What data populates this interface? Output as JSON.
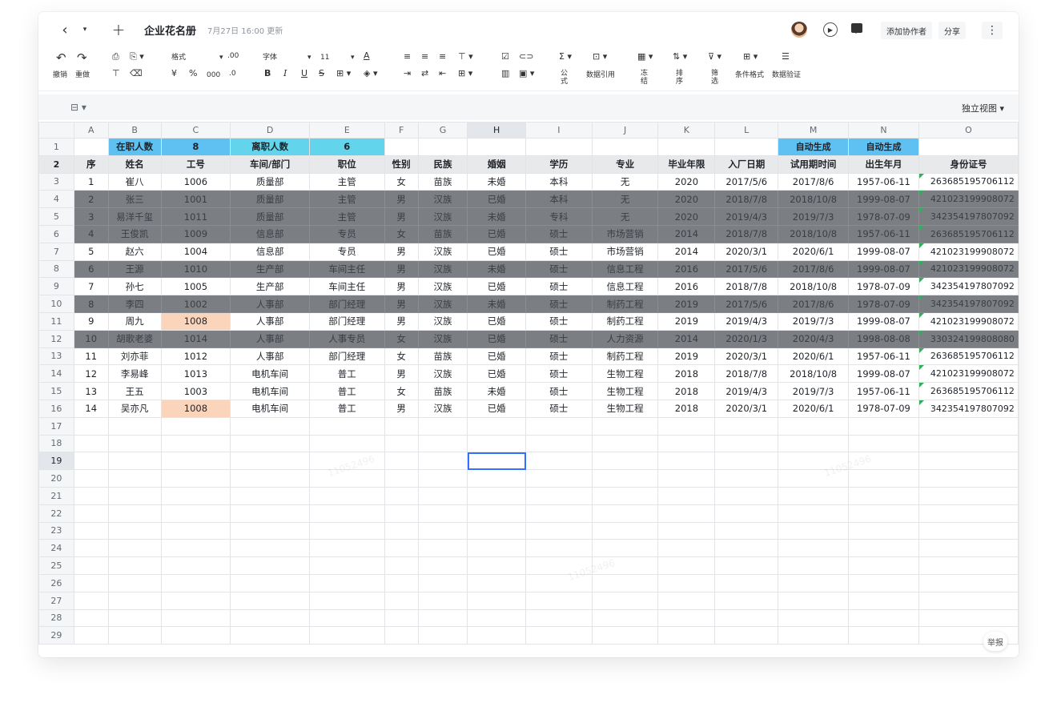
{
  "titlebar": {
    "back": "‹",
    "dropdown": "▾",
    "add": "+",
    "title": "企业花名册",
    "updated": "7月27日 16:00 更新",
    "add_collaborator": "添加协作者",
    "share": "分享",
    "more": "⋮"
  },
  "toolbar": {
    "undo": "撤销",
    "redo": "重做",
    "format": "格式",
    "font": "字体",
    "font_size": "11",
    "currency": "¥",
    "percent": "%",
    "thousands": "000",
    "decimal_inc": ".00",
    "decimal_dec": ".0",
    "bold": "B",
    "italic": "I",
    "underline": "U",
    "strike": "S",
    "formula": "公式",
    "data_ref": "数据引用",
    "freeze": "冻结",
    "sort": "排序",
    "filter": "筛选",
    "cond_format": "条件格式",
    "data_validation": "数据验证"
  },
  "bar2": {
    "view_icon": "⊟ ▾",
    "independent_view": "独立视图 ▾"
  },
  "grid": {
    "columns": [
      "A",
      "B",
      "C",
      "D",
      "E",
      "F",
      "G",
      "H",
      "I",
      "J",
      "K",
      "L",
      "M",
      "N",
      "O"
    ],
    "summary": {
      "active_label": "在职人数",
      "active_value": "8",
      "left_label": "离职人数",
      "left_value": "6",
      "auto1": "自动生成",
      "auto2": "自动生成"
    },
    "headers": [
      "序",
      "姓名",
      "工号",
      "车间/部门",
      "职位",
      "性别",
      "民族",
      "婚姻",
      "学历",
      "专业",
      "毕业年限",
      "入厂日期",
      "试用期时间",
      "出生年月",
      "身份证号"
    ],
    "rows": [
      {
        "n": "3",
        "dark": false,
        "cells": [
          "1",
          "崔八",
          "1006",
          "质量部",
          "主管",
          "女",
          "苗族",
          "未婚",
          "本科",
          "无",
          "2020",
          "2017/5/6",
          "2017/8/6",
          "1957-06-11",
          "263685195706112"
        ]
      },
      {
        "n": "4",
        "dark": true,
        "cells": [
          "2",
          "张三",
          "1001",
          "质量部",
          "主管",
          "男",
          "汉族",
          "已婚",
          "本科",
          "无",
          "2020",
          "2018/7/8",
          "2018/10/8",
          "1999-08-07",
          "421023199908072"
        ]
      },
      {
        "n": "5",
        "dark": true,
        "cells": [
          "3",
          "易洋千玺",
          "1011",
          "质量部",
          "主管",
          "男",
          "汉族",
          "未婚",
          "专科",
          "无",
          "2020",
          "2019/4/3",
          "2019/7/3",
          "1978-07-09",
          "342354197807092"
        ]
      },
      {
        "n": "6",
        "dark": true,
        "cells": [
          "4",
          "王俊凯",
          "1009",
          "信息部",
          "专员",
          "女",
          "苗族",
          "已婚",
          "硕士",
          "市场营销",
          "2014",
          "2018/7/8",
          "2018/10/8",
          "1957-06-11",
          "263685195706112"
        ]
      },
      {
        "n": "7",
        "dark": false,
        "cells": [
          "5",
          "赵六",
          "1004",
          "信息部",
          "专员",
          "男",
          "汉族",
          "已婚",
          "硕士",
          "市场营销",
          "2014",
          "2020/3/1",
          "2020/6/1",
          "1999-08-07",
          "421023199908072"
        ]
      },
      {
        "n": "8",
        "dark": true,
        "cells": [
          "6",
          "王源",
          "1010",
          "生产部",
          "车间主任",
          "男",
          "汉族",
          "未婚",
          "硕士",
          "信息工程",
          "2016",
          "2017/5/6",
          "2017/8/6",
          "1999-08-07",
          "421023199908072"
        ]
      },
      {
        "n": "9",
        "dark": false,
        "cells": [
          "7",
          "孙七",
          "1005",
          "生产部",
          "车间主任",
          "男",
          "汉族",
          "已婚",
          "硕士",
          "信息工程",
          "2016",
          "2018/7/8",
          "2018/10/8",
          "1978-07-09",
          "342354197807092"
        ]
      },
      {
        "n": "10",
        "dark": true,
        "cells": [
          "8",
          "李四",
          "1002",
          "人事部",
          "部门经理",
          "男",
          "汉族",
          "未婚",
          "硕士",
          "制药工程",
          "2019",
          "2017/5/6",
          "2017/8/6",
          "1978-07-09",
          "342354197807092"
        ]
      },
      {
        "n": "11",
        "dark": false,
        "peach": true,
        "cells": [
          "9",
          "周九",
          "1008",
          "人事部",
          "部门经理",
          "男",
          "汉族",
          "已婚",
          "硕士",
          "制药工程",
          "2019",
          "2019/4/3",
          "2019/7/3",
          "1999-08-07",
          "421023199908072"
        ]
      },
      {
        "n": "12",
        "dark": true,
        "cells": [
          "10",
          "胡歌老婆",
          "1014",
          "人事部",
          "人事专员",
          "女",
          "汉族",
          "已婚",
          "硕士",
          "人力资源",
          "2014",
          "2020/1/3",
          "2020/4/3",
          "1998-08-08",
          "330324199808080"
        ]
      },
      {
        "n": "13",
        "dark": false,
        "cells": [
          "11",
          "刘亦菲",
          "1012",
          "人事部",
          "部门经理",
          "女",
          "苗族",
          "已婚",
          "硕士",
          "制药工程",
          "2019",
          "2020/3/1",
          "2020/6/1",
          "1957-06-11",
          "263685195706112"
        ]
      },
      {
        "n": "14",
        "dark": false,
        "cells": [
          "12",
          "李易峰",
          "1013",
          "电机车间",
          "普工",
          "男",
          "汉族",
          "已婚",
          "硕士",
          "生物工程",
          "2018",
          "2018/7/8",
          "2018/10/8",
          "1999-08-07",
          "421023199908072"
        ]
      },
      {
        "n": "15",
        "dark": false,
        "cells": [
          "13",
          "王五",
          "1003",
          "电机车间",
          "普工",
          "女",
          "苗族",
          "未婚",
          "硕士",
          "生物工程",
          "2018",
          "2019/4/3",
          "2019/7/3",
          "1957-06-11",
          "263685195706112"
        ]
      },
      {
        "n": "16",
        "dark": false,
        "peach": true,
        "cells": [
          "14",
          "吴亦凡",
          "1008",
          "电机车间",
          "普工",
          "男",
          "汉族",
          "已婚",
          "硕士",
          "生物工程",
          "2018",
          "2020/3/1",
          "2020/6/1",
          "1978-07-09",
          "342354197807092"
        ]
      }
    ],
    "empty_rows": [
      "17",
      "18",
      "19",
      "20",
      "21",
      "22",
      "23",
      "24",
      "25",
      "26",
      "27",
      "28",
      "29"
    ],
    "selected_row": "19",
    "selected_col": "H"
  },
  "report": "举报",
  "colors": {
    "summary_blue": "#5fc1f2",
    "summary_cyan": "#62d5ec",
    "dark_row": "#7b7f84",
    "peach": "#fbd4bc",
    "accent": "#3370ff"
  }
}
